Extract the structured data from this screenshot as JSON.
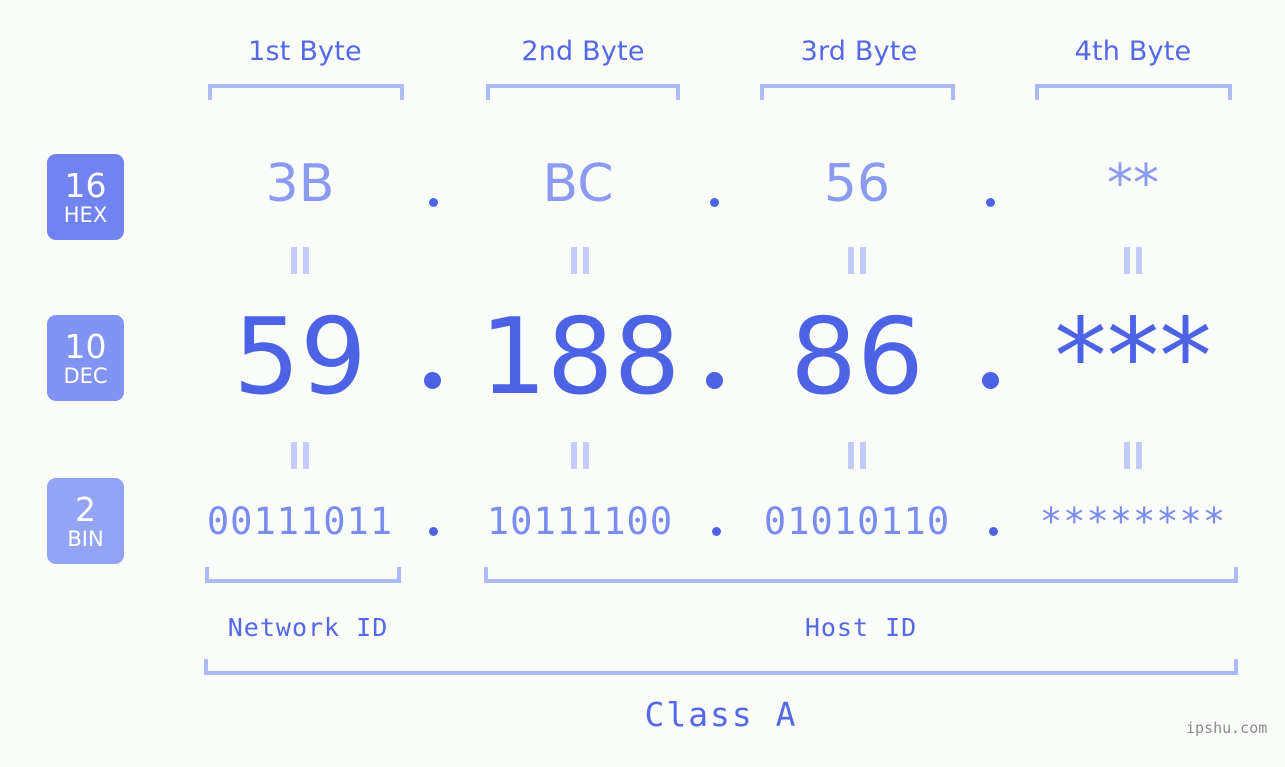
{
  "background_color": "#fafdfa",
  "accent_color": "#4c63e6",
  "bracket_color": "#adbaf8",
  "byte_headers": [
    {
      "label": "1st Byte"
    },
    {
      "label": "2nd Byte"
    },
    {
      "label": "3rd Byte"
    },
    {
      "label": "4th Byte"
    }
  ],
  "rows": {
    "hex": {
      "badge_number": "16",
      "badge_abbr": "HEX",
      "badge_color": "#7183ef",
      "text_color": "#8b9bf0",
      "values": [
        "3B",
        "BC",
        "56",
        "**"
      ],
      "separator": "."
    },
    "dec": {
      "badge_number": "10",
      "badge_abbr": "DEC",
      "badge_color": "#8294f2",
      "text_color": "#4c63e6",
      "values": [
        "59",
        "188",
        "86",
        "***"
      ],
      "separator": "."
    },
    "bin": {
      "badge_number": "2",
      "badge_abbr": "BIN",
      "badge_color": "#93a4f5",
      "text_color": "#7a8cf0",
      "values": [
        "00111011",
        "10111100",
        "01010110",
        "********"
      ],
      "separator": "."
    }
  },
  "equality_marks": {
    "glyph": "||",
    "count_per_gap": 4,
    "gaps": 2
  },
  "id_labels": [
    {
      "label": "Network ID"
    },
    {
      "label": "Host ID"
    }
  ],
  "class_label": "Class A",
  "watermark": "ipshu.com"
}
